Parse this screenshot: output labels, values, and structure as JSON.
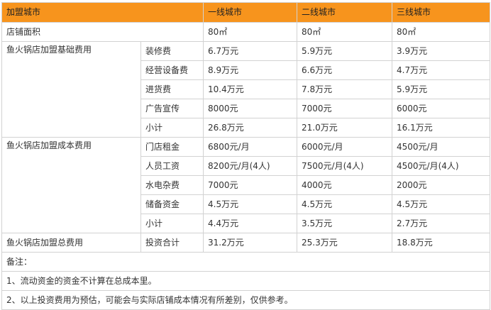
{
  "header": {
    "col0": "加盟城市",
    "col1": "一线城市",
    "col2": "二线城市",
    "col3": "三线城市"
  },
  "area": {
    "label": "店铺面积",
    "values": [
      "80㎡",
      "80㎡",
      "80㎡"
    ]
  },
  "basic_fee": {
    "group": "鱼火锅店加盟基础费用",
    "rows": [
      {
        "item": "装修费",
        "values": [
          "6.7万元",
          "5.9万元",
          "3.9万元"
        ]
      },
      {
        "item": "经营设备费",
        "values": [
          "8.9万元",
          "6.6万元",
          "4.7万元"
        ]
      },
      {
        "item": "进货费",
        "values": [
          "10.4万元",
          "7.8万元",
          "5.9万元"
        ]
      },
      {
        "item": "广告宣传",
        "values": [
          "8000元",
          "7000元",
          "6000元"
        ]
      },
      {
        "item": "小计",
        "values": [
          "26.8万元",
          "21.0万元",
          "16.1万元"
        ]
      }
    ]
  },
  "cost_fee": {
    "group": "鱼火锅店加盟成本费用",
    "rows": [
      {
        "item": "门店租金",
        "values": [
          "6800元/月",
          "6000元/月",
          "4500元/月"
        ]
      },
      {
        "item": "人员工资",
        "values": [
          "8200元/月(4人)",
          "7500元/月(4人)",
          "4500元/月(4人)"
        ]
      },
      {
        "item": "水电杂费",
        "values": [
          "7000元",
          "4000元",
          "2000元"
        ]
      },
      {
        "item": "储备资金",
        "values": [
          "4.5万元",
          "4.5万元",
          "4.5万元"
        ]
      },
      {
        "item": "小计",
        "values": [
          "4.4万元",
          "3.5万元",
          "2.7万元"
        ]
      }
    ]
  },
  "total_fee": {
    "group": "鱼火锅店加盟总费用",
    "item": "投资合计",
    "values": [
      "31.2万元",
      "25.3万元",
      "18.8万元"
    ]
  },
  "notes": {
    "title": "备注：",
    "lines": [
      "1、流动资金的资金不计算在总成本里。",
      "2、以上投资费用为预估，可能会与实际店铺成本情况有所差别，仅供参考。"
    ]
  },
  "colors": {
    "header_bg": "#f7941d",
    "border": "#d2d2d2",
    "text": "#333333"
  }
}
